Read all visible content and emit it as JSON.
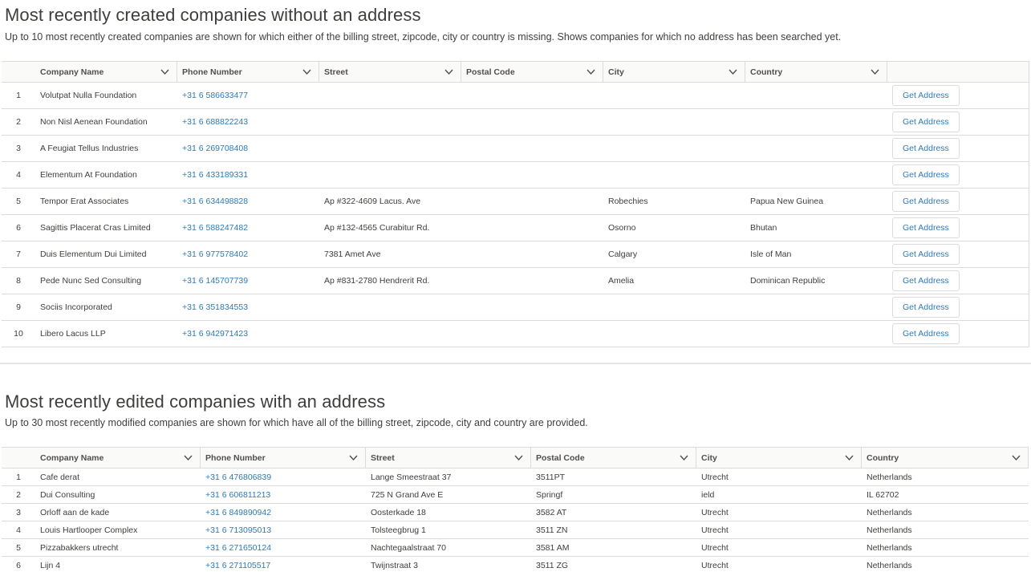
{
  "section1": {
    "title": "Most recently created companies without an address",
    "description": "Up to 10 most recently created companies are shown for which either of the billing street, zipcode, city or country is missing. Shows companies for which no address has been searched yet.",
    "columns": [
      "Company Name",
      "Phone Number",
      "Street",
      "Postal Code",
      "City",
      "Country"
    ],
    "action_label": "Get Address",
    "rows": [
      {
        "num": "1",
        "company": "Volutpat Nulla Foundation",
        "phone": "+31 6 586633477",
        "street": "",
        "postal": "",
        "city": "",
        "country": ""
      },
      {
        "num": "2",
        "company": "Non Nisl Aenean Foundation",
        "phone": "+31 6 688822243",
        "street": "",
        "postal": "",
        "city": "",
        "country": ""
      },
      {
        "num": "3",
        "company": "A Feugiat Tellus Industries",
        "phone": "+31 6 269708408",
        "street": "",
        "postal": "",
        "city": "",
        "country": ""
      },
      {
        "num": "4",
        "company": "Elementum At Foundation",
        "phone": "+31 6 433189331",
        "street": "",
        "postal": "",
        "city": "",
        "country": ""
      },
      {
        "num": "5",
        "company": "Tempor Erat Associates",
        "phone": "+31 6 634498828",
        "street": "Ap #322-4609 Lacus. Ave",
        "postal": "",
        "city": "Robechies",
        "country": "Papua New Guinea"
      },
      {
        "num": "6",
        "company": "Sagittis Placerat Cras Limited",
        "phone": "+31 6 588247482",
        "street": "Ap #132-4565 Curabitur Rd.",
        "postal": "",
        "city": "Osorno",
        "country": "Bhutan"
      },
      {
        "num": "7",
        "company": "Duis Elementum Dui Limited",
        "phone": "+31 6 977578402",
        "street": "7381 Amet Ave",
        "postal": "",
        "city": "Calgary",
        "country": "Isle of Man"
      },
      {
        "num": "8",
        "company": "Pede Nunc Sed Consulting",
        "phone": "+31 6 145707739",
        "street": "Ap #831-2780 Hendrerit Rd.",
        "postal": "",
        "city": "Amelia",
        "country": "Dominican Republic"
      },
      {
        "num": "9",
        "company": "Sociis Incorporated",
        "phone": "+31 6 351834553",
        "street": "",
        "postal": "",
        "city": "",
        "country": ""
      },
      {
        "num": "10",
        "company": "Libero Lacus LLP",
        "phone": "+31 6 942971423",
        "street": "",
        "postal": "",
        "city": "",
        "country": ""
      }
    ]
  },
  "section2": {
    "title": "Most recently edited companies with an address",
    "description": "Up to 30 most recently modified companies are shown for which have all of the billing street, zipcode, city and country are provided.",
    "columns": [
      "Company Name",
      "Phone Number",
      "Street",
      "Postal Code",
      "City",
      "Country"
    ],
    "rows": [
      {
        "num": "1",
        "company": "Cafe derat",
        "phone": "+31 6 476806839",
        "street": "Lange Smeestraat 37",
        "postal": "3511PT",
        "city": "Utrecht",
        "country": "Netherlands"
      },
      {
        "num": "2",
        "company": "Dui Consulting",
        "phone": "+31 6 606811213",
        "street": "725 N Grand Ave E",
        "postal": "Springf",
        "city": "ield",
        "country": "IL 62702"
      },
      {
        "num": "3",
        "company": "Orloff aan de kade",
        "phone": "+31 6 849890942",
        "street": "Oosterkade 18",
        "postal": "3582 AT",
        "city": "Utrecht",
        "country": "Netherlands"
      },
      {
        "num": "4",
        "company": "Louis Hartlooper Complex",
        "phone": "+31 6 713095013",
        "street": "Tolsteegbrug 1",
        "postal": "3511 ZN",
        "city": "Utrecht",
        "country": "Netherlands"
      },
      {
        "num": "5",
        "company": "Pizzabakkers utrecht",
        "phone": "+31 6 271650124",
        "street": "Nachtegaalstraat 70",
        "postal": "3581 AM",
        "city": "Utrecht",
        "country": "Netherlands"
      },
      {
        "num": "6",
        "company": "Lijn 4",
        "phone": "+31 6 271105517",
        "street": "Twijnstraat 3",
        "postal": "3511 ZG",
        "city": "Utrecht",
        "country": "Netherlands"
      }
    ]
  }
}
